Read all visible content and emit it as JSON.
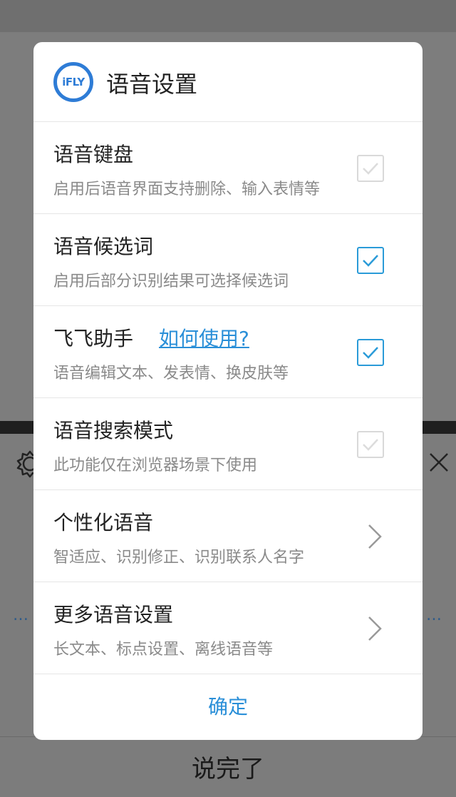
{
  "dialog": {
    "logo_text": "iFLY",
    "title": "语音设置",
    "ok_label": "确定"
  },
  "rows": [
    {
      "title": "语音键盘",
      "subtitle": "启用后语音界面支持删除、输入表情等",
      "control": "checkbox",
      "checked": false
    },
    {
      "title": "语音候选词",
      "subtitle": "启用后部分识别结果可选择候选词",
      "control": "checkbox",
      "checked": true
    },
    {
      "title": "飞飞助手",
      "link": "如何使用?",
      "subtitle": "语音编辑文本、发表情、换皮肤等",
      "control": "checkbox",
      "checked": true
    },
    {
      "title": "语音搜索模式",
      "subtitle": "此功能仅在浏览器场景下使用",
      "control": "checkbox",
      "checked": false
    },
    {
      "title": "个性化语音",
      "subtitle": "智适应、识别修正、识别联系人名字",
      "control": "chevron"
    },
    {
      "title": "更多语音设置",
      "subtitle": "长文本、标点设置、离线语音等",
      "control": "chevron"
    }
  ],
  "background": {
    "dots_left": "…",
    "dots_right": "…",
    "done_label": "说完了"
  },
  "colors": {
    "accent": "#2a8fd8",
    "checkbox_on": "#2a9bd8",
    "checkbox_off": "#d9d9d9",
    "logo": "#2e7cd6"
  }
}
